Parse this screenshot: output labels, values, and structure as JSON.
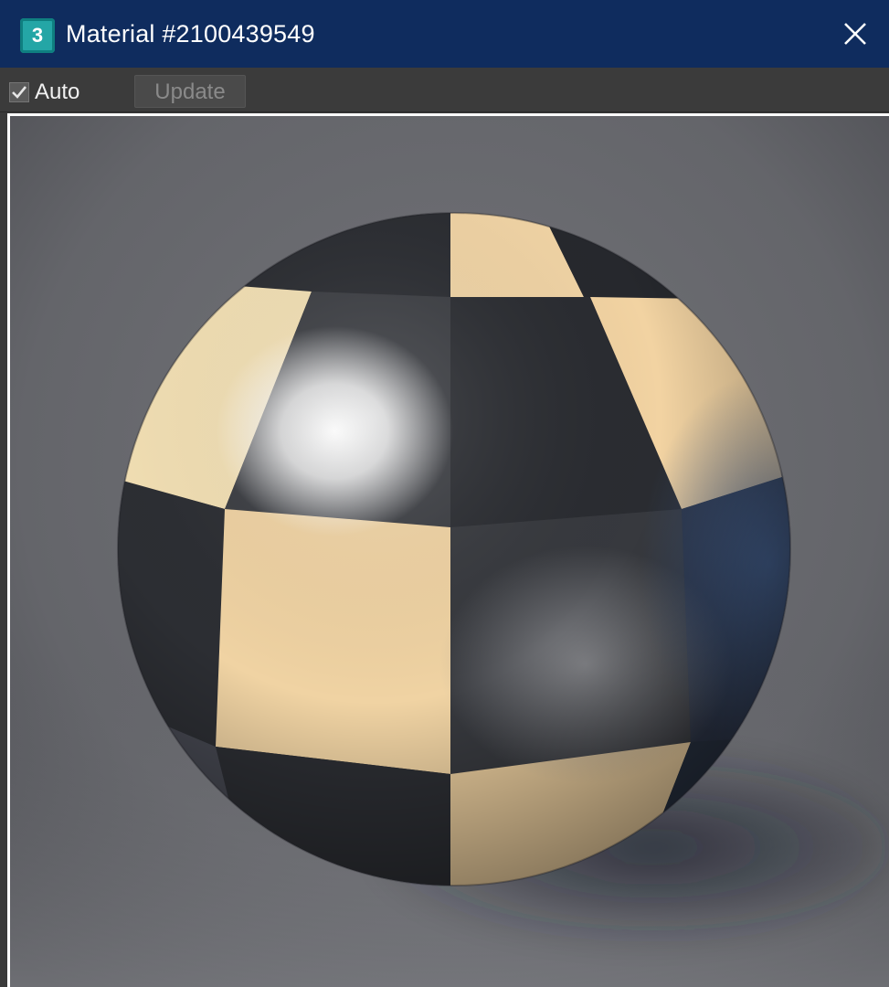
{
  "window": {
    "title": "Material #2100439549",
    "app_icon_glyph": "3",
    "app_icon": "3dsmax-app-icon",
    "close_icon": "close-icon"
  },
  "toolbar": {
    "auto_label": "Auto",
    "auto_checked": true,
    "update_label": "Update",
    "update_enabled": false
  },
  "viewport": {
    "subject": "sphere",
    "material_colors": {
      "light_tile": "#f2d3a2",
      "dark_tile": "#2c2e33",
      "background": "#6d6e73"
    }
  },
  "colors": {
    "titlebar": "#0f2c5e",
    "toolbar": "#3b3b3b",
    "frame": "#ffffff"
  }
}
